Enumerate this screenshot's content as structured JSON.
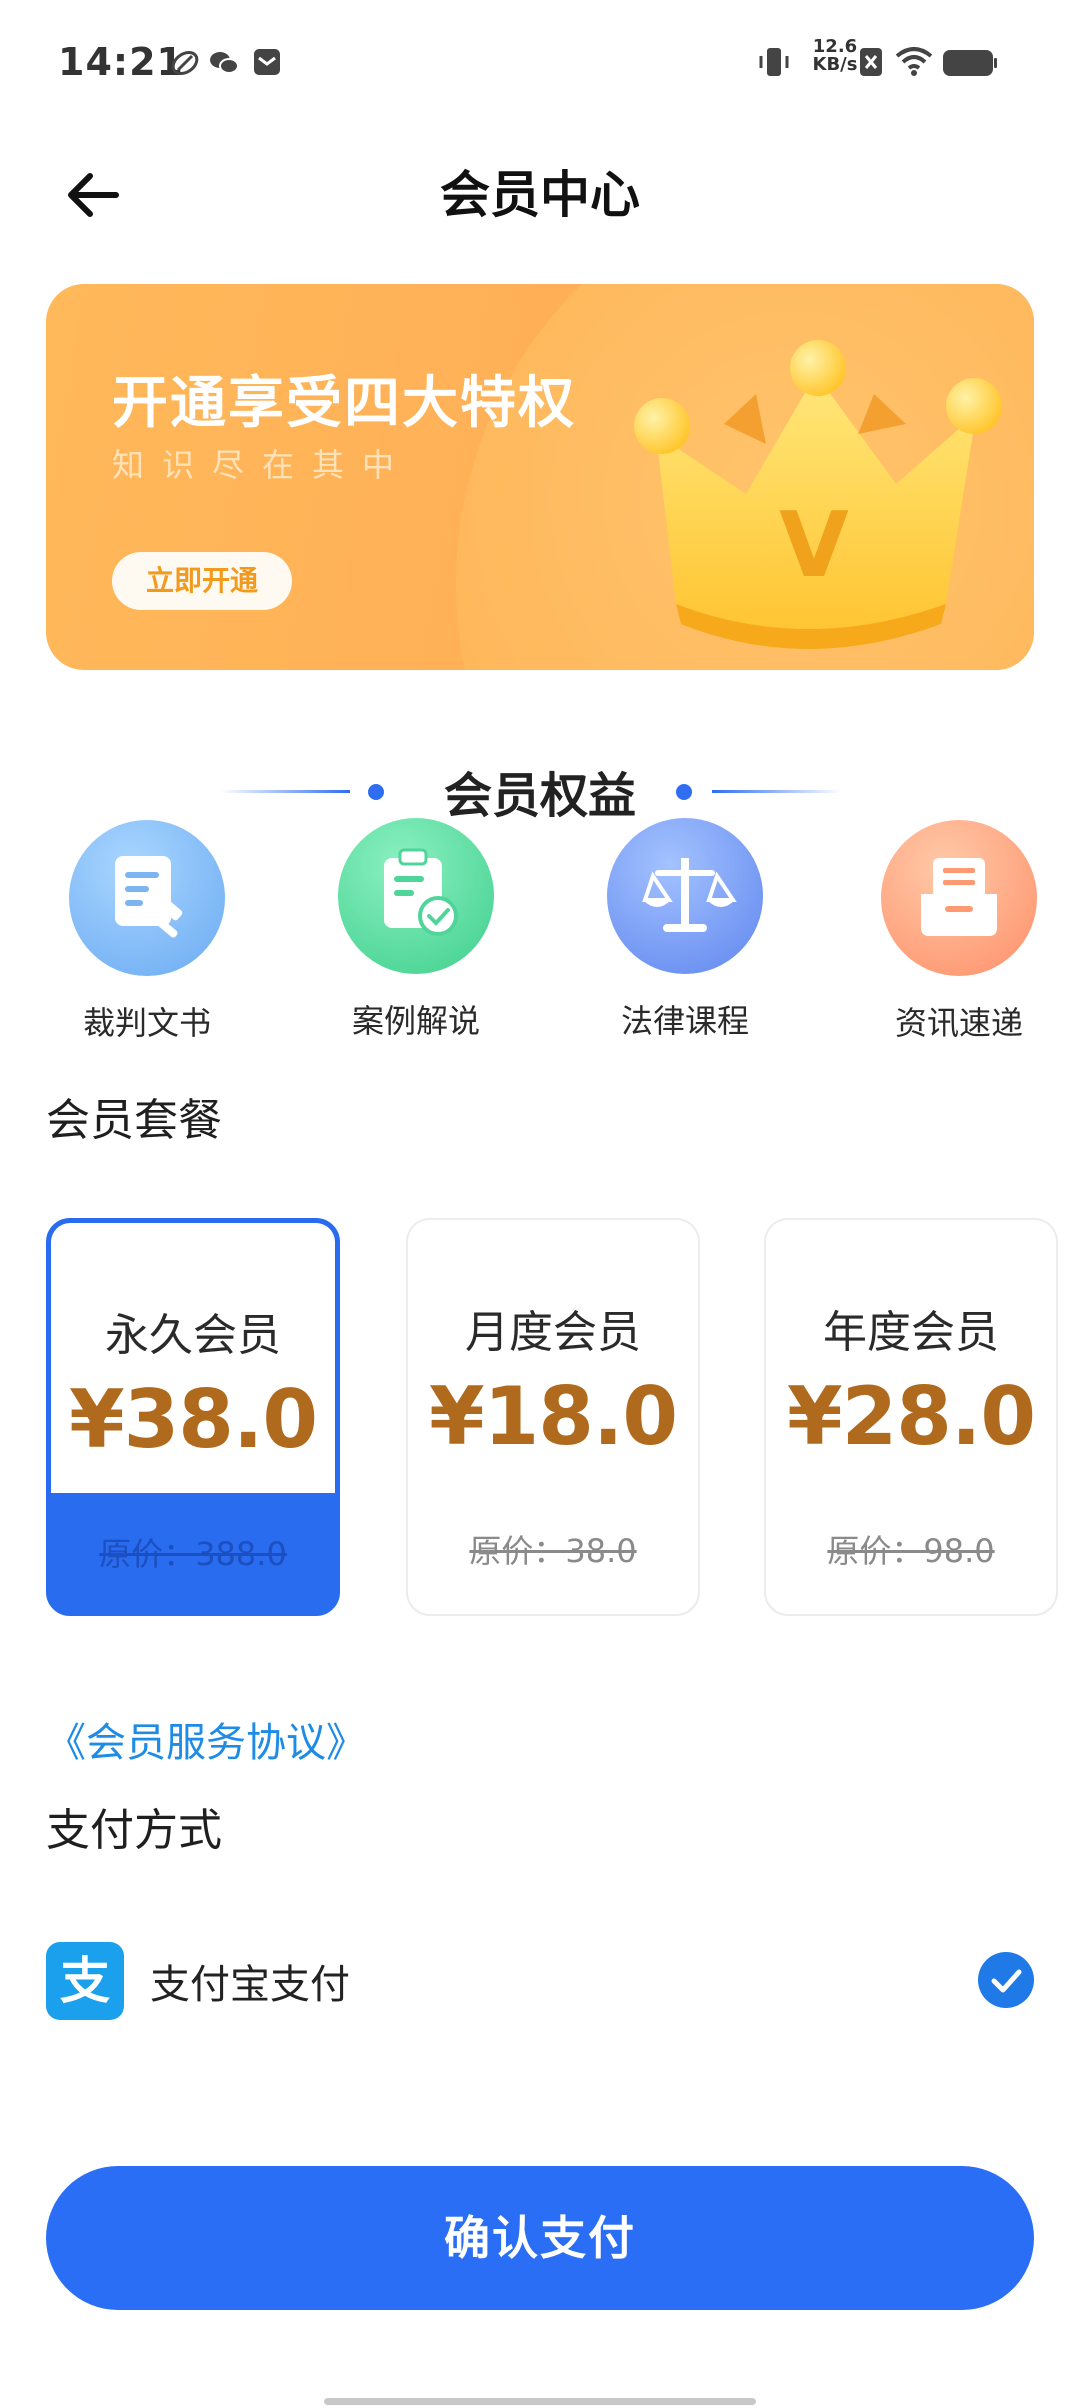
{
  "status_bar": {
    "time": "14:21",
    "net_speed_value": "12.6",
    "net_speed_unit": "KB/s"
  },
  "header": {
    "title": "会员中心"
  },
  "banner": {
    "title": "开通享受四大特权",
    "subtitle": "知识尽在其中",
    "cta": "立即开通",
    "crown_letter": "V"
  },
  "benefits": {
    "title": "会员权益",
    "items": [
      {
        "label": "裁判文书",
        "icon": "document-gavel-icon",
        "color": "#6fb0f5"
      },
      {
        "label": "案例解说",
        "icon": "clipboard-check-icon",
        "color": "#4fd59a"
      },
      {
        "label": "法律课程",
        "icon": "scales-icon",
        "color": "#6d8ff2"
      },
      {
        "label": "资讯速递",
        "icon": "news-tray-icon",
        "color": "#ff9a72"
      }
    ]
  },
  "plans": {
    "title": "会员套餐",
    "items": [
      {
        "name": "永久会员",
        "price": "¥38.0",
        "original": "原价：388.0",
        "selected": true
      },
      {
        "name": "月度会员",
        "price": "¥18.0",
        "original": "原价：38.0",
        "selected": false
      },
      {
        "name": "年度会员",
        "price": "¥28.0",
        "original": "原价：98.0",
        "selected": false
      }
    ]
  },
  "agreement": "《会员服务协议》",
  "payment": {
    "title": "支付方式",
    "method_label": "支付宝支付",
    "method_icon_char": "支",
    "selected": true
  },
  "confirm_button": "确认支付",
  "colors": {
    "primary": "#2b6ef6",
    "price": "#b06a1d",
    "banner": "#ffb057",
    "link": "#1e8be6"
  }
}
